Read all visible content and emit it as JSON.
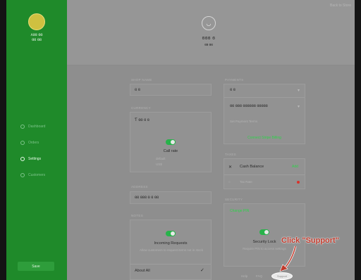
{
  "sidebar": {
    "avatar_text": "",
    "user_name_line1": "ʌɞɞ ɞɞ",
    "user_name_line2": "ɞɞ ɞɞ",
    "items": [
      {
        "label": "Dashboard"
      },
      {
        "label": "Orders"
      },
      {
        "label": "Settings"
      },
      {
        "label": "Customers"
      }
    ],
    "sign_out_label": "Save"
  },
  "header": {
    "top_right": "Back to Store",
    "logo_glyph": "◡",
    "shop_name": "ɞɞɞ ɞ",
    "shop_sub": "ɞɞ ɞɞ"
  },
  "left_col": {
    "section1_label": "SHOP NAME",
    "shop_name_value": "ɞ  ɞ",
    "section2_label": "CURRENCY",
    "currency_value": "Ƭ ɞɞ ɞ  ɞ",
    "call_rate_label": "Call rate",
    "call_rate_detail1": "default",
    "call_rate_detail2": "US$",
    "section3_label": "ADDRESS",
    "address_value": "ɞɞ ɞɞɞ ɞ  ɞ  ɞɞ",
    "section4_label": "NOTES",
    "incoming_label": "Incoming Requests",
    "incoming_hint": "Allow customers to request items not in stock",
    "about_label": "About All"
  },
  "right_col": {
    "section1_label": "PAYMENTS",
    "pay_value1": "ɞ     ɞ",
    "pay_value2": "ɞɞ ɞɞɞ ɞɞɞɞɞɞ ɞɞɞɞɞ",
    "pay_hint": "Set Payment Terms",
    "pay_link": "Connect Stripe Billing",
    "section2_label": "TAXES",
    "cash_label": "Cash Balance",
    "cash_link": "Add",
    "tax_item": "Tax Rate",
    "section3_label": "SECURITY",
    "security_link": "Change PIN",
    "security_label": "Security Lock",
    "security_hint": "Require PIN to access settings",
    "footer_left": "Help",
    "footer_mid": "FAQ"
  },
  "annotation": {
    "text": "Click \"Support\"",
    "button_label": "Support"
  },
  "colors": {
    "sidebar": "#1f8a2a",
    "accent": "#27b34a",
    "annotation": "#c0392b"
  }
}
